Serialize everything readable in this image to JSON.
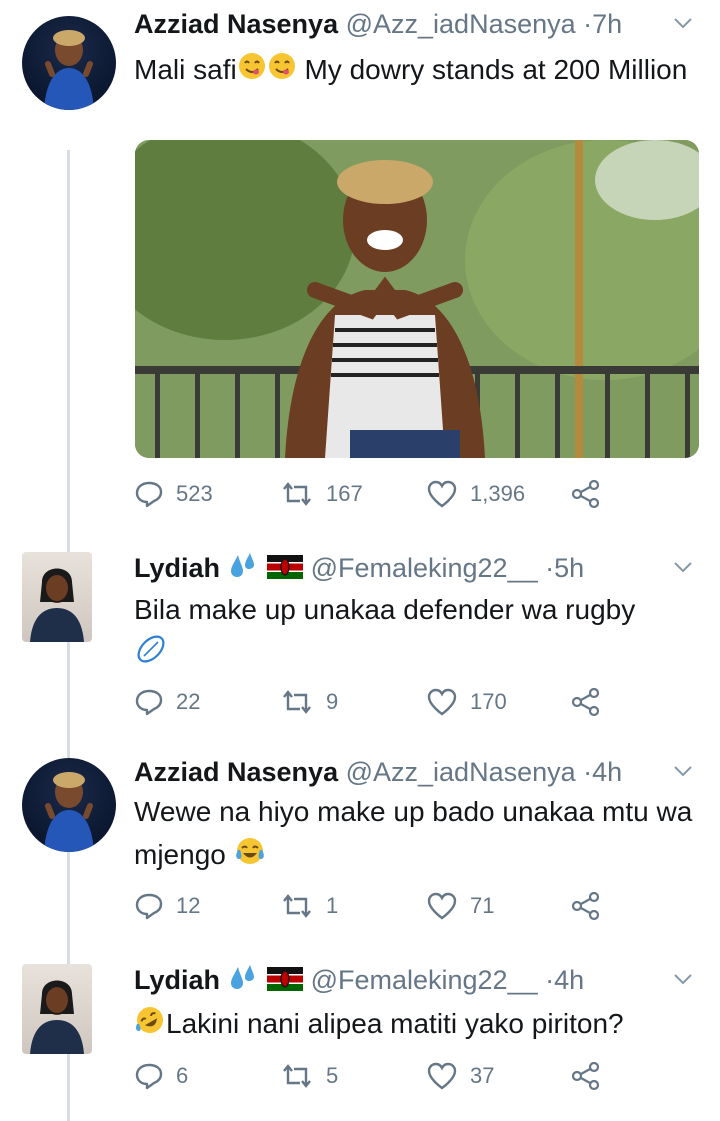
{
  "tweets": [
    {
      "name": "Azziad Nasenya",
      "handle": "@Azz_iadNasenya",
      "time": "7h",
      "text_before": "Mali safi",
      "text_after": " My dowry stands at 200 Million",
      "replies": "523",
      "retweets": "167",
      "likes": "1,396"
    },
    {
      "name": "Lydiah",
      "handle": "@Femaleking22__",
      "time": "5h",
      "text": "Bila make up unakaa defender  wa rugby",
      "replies": "22",
      "retweets": "9",
      "likes": "170"
    },
    {
      "name": "Azziad Nasenya",
      "handle": "@Azz_iadNasenya",
      "time": "4h",
      "text": "Wewe na hiyo make up bado unakaa mtu wa mjengo",
      "replies": "12",
      "retweets": "1",
      "likes": "71"
    },
    {
      "name": "Lydiah",
      "handle": "@Femaleking22__",
      "time": "4h",
      "text": "Lakini nani alipea matiti yako piriton?",
      "replies": "6",
      "retweets": "5",
      "likes": "37"
    }
  ],
  "icons": {
    "reply": "reply-icon",
    "retweet": "retweet-icon",
    "like": "heart-icon",
    "share": "share-icon",
    "chevron": "chevron-down-icon"
  },
  "colors": {
    "text": "#14171a",
    "secondary": "#657786",
    "thread_line": "#d6dde3",
    "emoji_yellow": "#f7c531",
    "flag_red": "#bb0000",
    "flag_green": "#006600"
  }
}
